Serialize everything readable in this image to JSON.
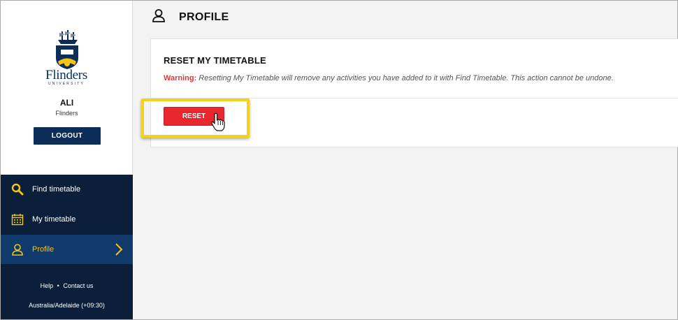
{
  "sidebar": {
    "logo": {
      "name": "Flinders",
      "sub": "UNIVERSITY"
    },
    "user": {
      "name": "ALI",
      "institution": "Flinders"
    },
    "logout_label": "LOGOUT",
    "nav": [
      {
        "label": "Find timetable",
        "icon": "search-icon"
      },
      {
        "label": "My timetable",
        "icon": "calendar-icon"
      },
      {
        "label": "Profile",
        "icon": "user-icon",
        "active": true
      }
    ],
    "footer": {
      "help": "Help",
      "separator": "•",
      "contact": "Contact us",
      "timezone": "Australia/Adelaide (+09:30)"
    }
  },
  "main": {
    "page_title": "PROFILE",
    "card": {
      "title": "RESET MY TIMETABLE",
      "warning_label": "Warning:",
      "warning_text": " Resetting My Timetable will remove any activities you have added to it with Find Timetable. This action cannot be undone.",
      "reset_label": "RESET"
    }
  },
  "colors": {
    "navy": "#0b1f3a",
    "active": "#0f3a6b",
    "accent_yellow": "#f4c514",
    "danger": "#e8272e"
  }
}
